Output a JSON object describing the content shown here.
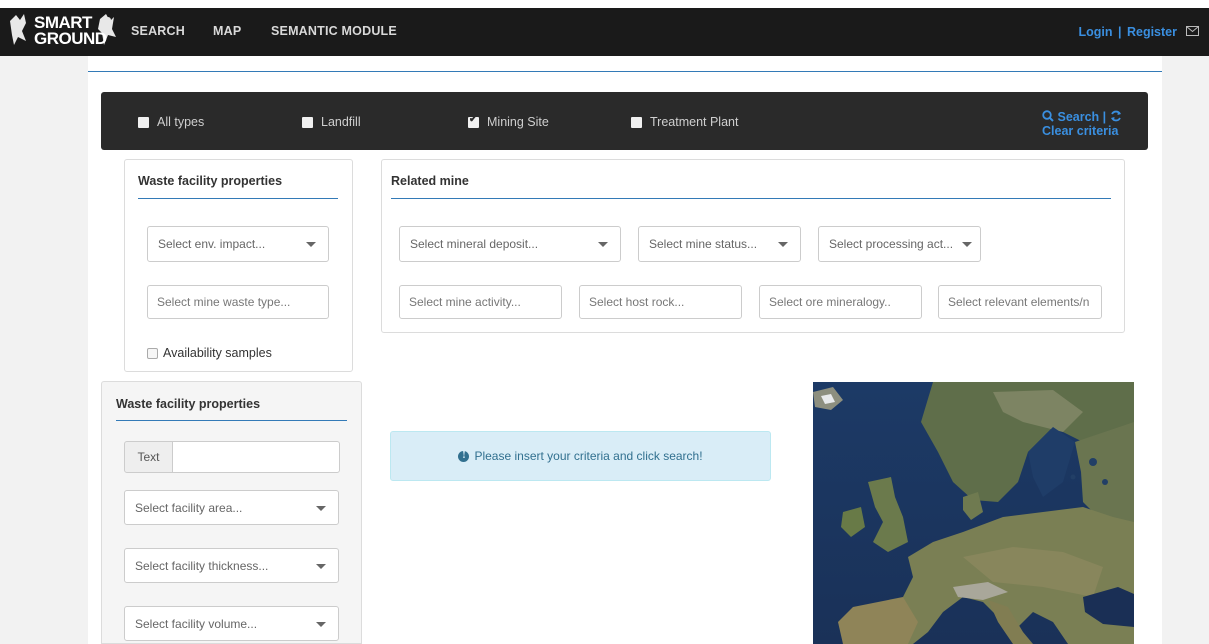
{
  "navbar": {
    "logo_text_line1": "SMART",
    "logo_text_line2": "GROUND",
    "items": [
      "SEARCH",
      "MAP",
      "SEMANTIC MODULE"
    ],
    "login": "Login",
    "separator": "|",
    "register": "Register"
  },
  "filter": {
    "options": [
      {
        "label": "All types",
        "checked": false
      },
      {
        "label": "Landfill",
        "checked": false
      },
      {
        "label": "Mining Site",
        "checked": true
      },
      {
        "label": "Treatment Plant",
        "checked": false
      }
    ],
    "search_label": "Search",
    "separator": "|",
    "clear_label": "Clear criteria"
  },
  "waste_panel": {
    "title": "Waste facility properties",
    "env_impact_placeholder": "Select env. impact...",
    "mine_waste_placeholder": "Select mine waste type...",
    "availability_label": "Availability samples"
  },
  "related_mine": {
    "title": "Related mine",
    "mineral_deposit_placeholder": "Select mineral deposit...",
    "mine_status_placeholder": "Select mine status...",
    "processing_placeholder": "Select processing act...",
    "mine_activity_placeholder": "Select mine activity...",
    "host_rock_placeholder": "Select host rock...",
    "ore_mineralogy_placeholder": "Select ore mineralogy..",
    "relevant_elements_placeholder": "Select relevant elements/n"
  },
  "facility_panel": {
    "title": "Waste facility properties",
    "text_addon": "Text",
    "text_value": "",
    "area_placeholder": "Select facility area...",
    "thickness_placeholder": "Select facility thickness...",
    "volume_placeholder": "Select facility volume..."
  },
  "info": {
    "message": "Please insert your criteria and click search!"
  },
  "colors": {
    "navbar_bg": "#1a1a1a",
    "accent_blue": "#3a8fe0",
    "info_bg": "#d9edf7",
    "info_text": "#31708f"
  }
}
